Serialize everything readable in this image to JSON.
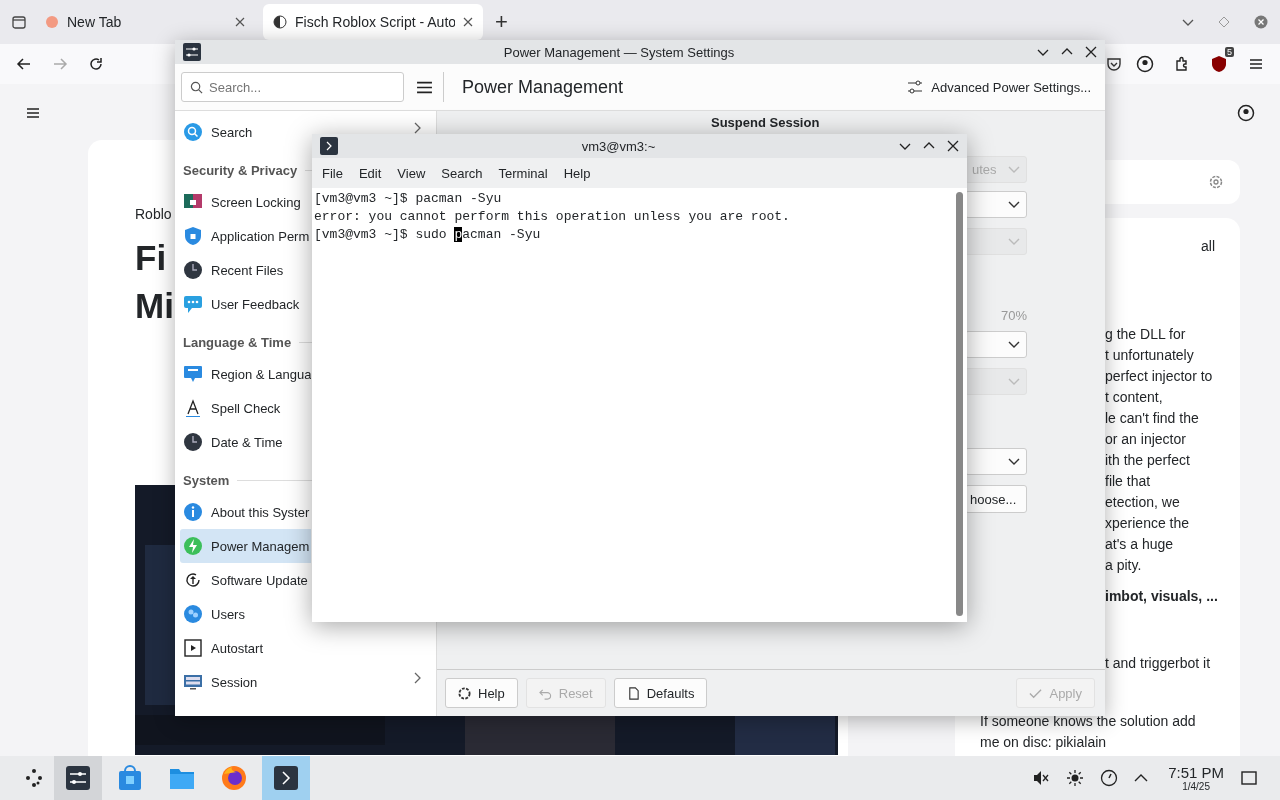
{
  "browser": {
    "tabs": [
      {
        "label": "New Tab",
        "selected": false
      },
      {
        "label": "Fisch Roblox Script - Auto",
        "selected": true
      }
    ],
    "new_tab": "+",
    "extension_badge": "5",
    "page": {
      "breadcrumb": "Roblo",
      "title_lines": [
        "Fi",
        "Mi"
      ],
      "filter_label": "all",
      "article_lines": [
        "g the DLL for",
        "t unfortunately",
        "perfect injector to",
        "t content,",
        "le can't find the",
        "or an injector",
        "ith the perfect",
        "file that",
        "etection, we",
        "xperience the",
        "at's a huge",
        "a pity."
      ],
      "bold_line": "imbot, visuals, ...",
      "line_after": "t and triggerbot it",
      "closing_lines": [
        "If someone knows the solution add",
        "me on disc: pikialain"
      ]
    }
  },
  "settings": {
    "title": "Power Management — System Settings",
    "search": {
      "placeholder": "Search..."
    },
    "page_title": "Power Management",
    "advanced": "Advanced Power Settings...",
    "sidebar": [
      {
        "kind": "item",
        "label": "Search",
        "selected": false,
        "has_children": true
      },
      {
        "kind": "header",
        "label": "Security & Privacy"
      },
      {
        "kind": "item",
        "label": "Screen Locking",
        "selected": false,
        "has_children": false
      },
      {
        "kind": "item",
        "label": "Application Perm",
        "selected": false,
        "has_children": false
      },
      {
        "kind": "item",
        "label": "Recent Files",
        "selected": false,
        "has_children": false
      },
      {
        "kind": "item",
        "label": "User Feedback",
        "selected": false,
        "has_children": false
      },
      {
        "kind": "header",
        "label": "Language & Time"
      },
      {
        "kind": "item",
        "label": "Region & Langua",
        "selected": false,
        "has_children": false
      },
      {
        "kind": "item",
        "label": "Spell Check",
        "selected": false,
        "has_children": false
      },
      {
        "kind": "item",
        "label": "Date & Time",
        "selected": false,
        "has_children": false
      },
      {
        "kind": "header",
        "label": "System"
      },
      {
        "kind": "item",
        "label": "About this Syster",
        "selected": false,
        "has_children": false
      },
      {
        "kind": "item",
        "label": "Power Managem",
        "selected": true,
        "has_children": false
      },
      {
        "kind": "item",
        "label": "Software Update",
        "selected": false,
        "has_children": false
      },
      {
        "kind": "item",
        "label": "Users",
        "selected": false,
        "has_children": false
      },
      {
        "kind": "item",
        "label": "Autostart",
        "selected": false,
        "has_children": false
      },
      {
        "kind": "item",
        "label": "Session",
        "selected": false,
        "has_children": true
      }
    ],
    "section_title": "Suspend Session",
    "controls": [
      {
        "kind": "combo",
        "value": "utes",
        "disabled": true
      },
      {
        "kind": "combo",
        "disabled": false
      },
      {
        "kind": "combo",
        "disabled": true
      },
      {
        "kind": "text",
        "value": "70%"
      },
      {
        "kind": "combo",
        "disabled": false
      },
      {
        "kind": "combo",
        "disabled": true
      },
      {
        "kind": "combo",
        "disabled": false
      },
      {
        "kind": "button",
        "value": "hoose...",
        "disabled": false
      }
    ],
    "footer": [
      {
        "label": "Help",
        "disabled": false
      },
      {
        "label": "Reset",
        "disabled": true
      },
      {
        "label": "Defaults",
        "disabled": false
      },
      {
        "label": "Apply",
        "disabled": true
      }
    ]
  },
  "terminal": {
    "title": "vm3@vm3:~",
    "menu": [
      "File",
      "Edit",
      "View",
      "Search",
      "Terminal",
      "Help"
    ],
    "lines": [
      {
        "before": "[vm3@vm3 ~]$ pacman -Syu"
      },
      {
        "before": "error: you cannot perform this operation unless you are root."
      },
      {
        "before": "[vm3@vm3 ~]$ sudo ",
        "cursor": "p",
        "after": "acman -Syu"
      }
    ]
  },
  "taskbar": {
    "apps": [
      {
        "selected": true
      },
      {
        "selected": false
      },
      {
        "selected": false
      },
      {
        "selected": false
      },
      {
        "selected": true
      }
    ],
    "time": "7:51 PM",
    "date": "1/4/25"
  }
}
